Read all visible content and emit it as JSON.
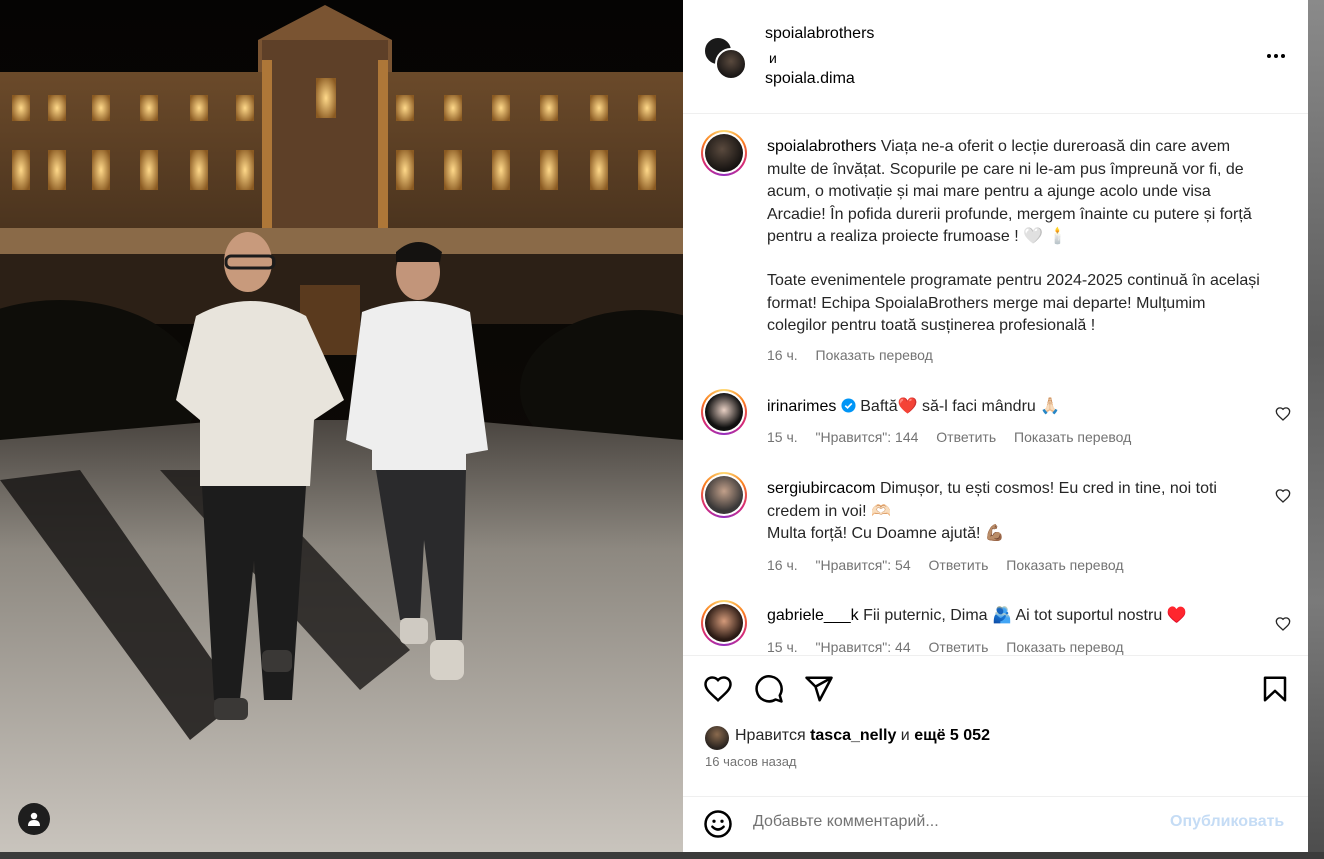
{
  "post": {
    "authors": [
      "spoialabrothers",
      "spoiala.dima"
    ],
    "and_word": "и",
    "caption_user": "spoialabrothers",
    "caption_p1": "Viața ne-a oferit o lecție dureroasă din care avem multe de învățat. Scopurile pe care ni le-am pus împreună vor fi, de acum, o motivație și mai mare pentru a ajunge acolo unde visa Arcadie! În pofida durerii profunde, mergem înainte cu putere și forță pentru a realiza proiecte frumoase ! 🤍 🕯️",
    "caption_p2": "Toate evenimentele programate pentru 2024-2025 continuă în același format! Echipa SpoialaBrothers merge mai departe! Mulțumim colegilor pentru toată susținerea profesională !",
    "caption_time": "16 ч.",
    "translate": "Показать перевод"
  },
  "comments": [
    {
      "user": "irinarimes",
      "text": "Baftă❤️  să-l faci mândru 🙏🏻",
      "time": "15 ч.",
      "likes": "\"Нравится\": 144",
      "reply": "Ответить",
      "translate": "Показать перевод"
    },
    {
      "user": "sergiubircacom",
      "text": "Dimușor, tu ești cosmos! Eu cred in tine, noi toti credem in voi! 🫶🏻",
      "text2": "Multa forță! Cu Doamne ajută! 💪🏽",
      "time": "16 ч.",
      "likes": "\"Нравится\": 54",
      "reply": "Ответить",
      "translate": "Показать перевод"
    },
    {
      "user": "gabriele___k",
      "text": "Fii puternic, Dima 🫂 Ai tot suportul nostru ♥️",
      "time": "15 ч.",
      "likes": "\"Нравится\": 44",
      "reply": "Ответить",
      "translate": "Показать перевод"
    }
  ],
  "likes_bar": {
    "prefix": "Нравится",
    "user": "tasca_nelly",
    "mid": "и",
    "more": "ещё 5 052"
  },
  "post_time": "16 часов назад",
  "composer": {
    "placeholder": "Добавьте комментарий...",
    "publish": "Опубликовать"
  },
  "icons": [
    "more-icon",
    "heart-icon",
    "comment-icon",
    "share-icon",
    "bookmark-icon",
    "emoji-icon",
    "verified-icon",
    "profile-icon"
  ],
  "colors": {
    "verified": "#0095f6",
    "muted": "#737373",
    "publish_disabled": "#c5dcf5"
  }
}
